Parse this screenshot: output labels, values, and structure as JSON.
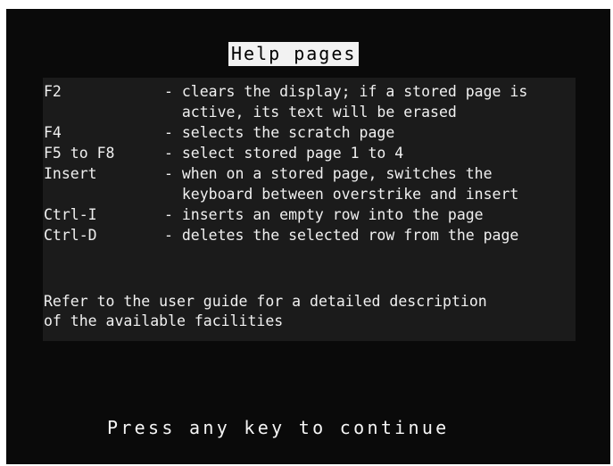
{
  "screen": {
    "title": "Help pages",
    "background_color": "#0a0a0a",
    "panel_color": "#1b1b1b",
    "text_color": "#f0f0f0",
    "title_background": "#f2f2f2"
  },
  "shortcuts": [
    {
      "key": "F2",
      "lines": [
        "- clears the display; if a stored page is",
        "  active, its text will be erased"
      ]
    },
    {
      "key": "F4",
      "lines": [
        "- selects the scratch page"
      ]
    },
    {
      "key": "F5 to F8",
      "lines": [
        "- select stored page 1 to 4"
      ]
    },
    {
      "key": "Insert",
      "lines": [
        "- when on a stored page, switches the",
        "  keyboard between overstrike and insert"
      ]
    },
    {
      "key": "Ctrl-I",
      "lines": [
        "- inserts an empty row into the page"
      ]
    },
    {
      "key": "Ctrl-D",
      "lines": [
        "- deletes the selected row from the page"
      ]
    }
  ],
  "note": {
    "line1": "Refer to the user guide for a detailed description",
    "line2": "of the available facilities"
  },
  "prompt": "Press any key to continue"
}
